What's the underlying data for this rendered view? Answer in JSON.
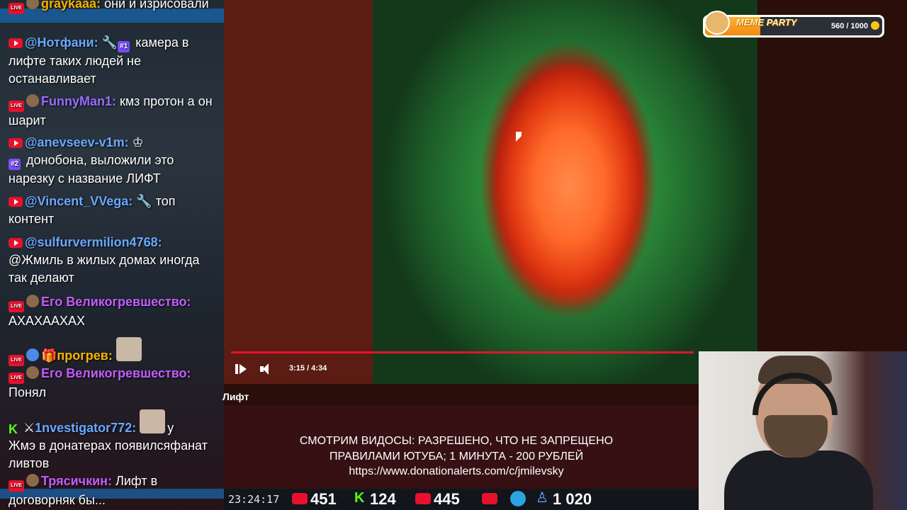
{
  "chat": {
    "messages": [
      {
        "name": "graykaaa:",
        "text": "они и изрисовали"
      },
      {
        "name": "@Нотфани:",
        "text": "камера в лифте таких людей не останавливает",
        "badge": "#1"
      },
      {
        "name": "FunnyMan1:",
        "text": "кмз протон а он шарит"
      },
      {
        "name": "@anevseev-v1m:",
        "text": "донобона, выложили это нарезку с название ЛИФТ",
        "badge": "#2"
      },
      {
        "name": "@Vincent_VVega:",
        "text": "топ контент"
      },
      {
        "name": "@sulfurvermilion4768:",
        "text": "@Жмиль в жилых домах иногда так делают"
      },
      {
        "name": "Его Великогревшество:",
        "text": "АХАХААХАХ"
      },
      {
        "name": "прогрев:",
        "text": ""
      },
      {
        "name": "Его Великогревшество:",
        "text": "Понял"
      },
      {
        "name": "1nvestigator772:",
        "text": "у",
        "text2": "Жмэ в донатерах появилсяфанат ливтов"
      },
      {
        "name": "Трясичкин:",
        "text": "Лифт в договорняк бы..."
      }
    ]
  },
  "player": {
    "time": "3:15 / 4:34",
    "progress": 0.99,
    "title": "Лифт"
  },
  "info": {
    "line1": "СМОТРИМ ВИДОСЫ: РАЗРЕШЕНО, ЧТО НЕ ЗАПРЕЩЕНО",
    "line2": "ПРАВИЛАМИ ЮТУБА; 1 МИНУТА - 200 РУБЛЕЙ",
    "line3": "https://www.donationalerts.com/c/jmilevsky"
  },
  "stats": {
    "clock": "23:24:17",
    "youtube": "451",
    "kick": "124",
    "live": "445",
    "telegram_users": "1 020"
  },
  "meme_party": {
    "title": "MEME PARTY",
    "count": "560 / 1000",
    "progress": 0.56
  },
  "colors": {
    "youtube": "#e8112d",
    "kick": "#53fc18",
    "accent": "#1a5fa0"
  }
}
